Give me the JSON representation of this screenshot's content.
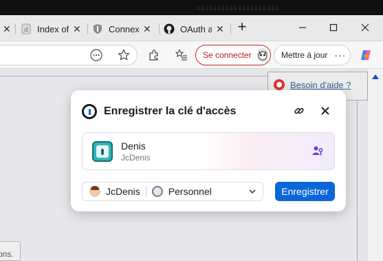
{
  "tabs": [
    {
      "label": "Index of",
      "icon": "document-icon"
    },
    {
      "label": "Connexi",
      "icon": "shield-icon"
    },
    {
      "label": "OAuth a",
      "icon": "github-icon"
    }
  ],
  "toolbar": {
    "connect_label": "Se connecter",
    "update_label": "Mettre à jour"
  },
  "page": {
    "help_label": "Besoin d'aide ?",
    "bottom_note": "ons."
  },
  "popup": {
    "title": "Enregistrer la clé d'accès",
    "credential": {
      "name": "Denis",
      "username": "JcDenis"
    },
    "account": "JcDenis",
    "vault": "Personnel",
    "save_label": "Enregistrer"
  },
  "colors": {
    "save_button": "#0a66d9",
    "connect_border": "#c62828",
    "help_link": "#3a5f9c",
    "passkey_icon": "#6a3fd0"
  }
}
